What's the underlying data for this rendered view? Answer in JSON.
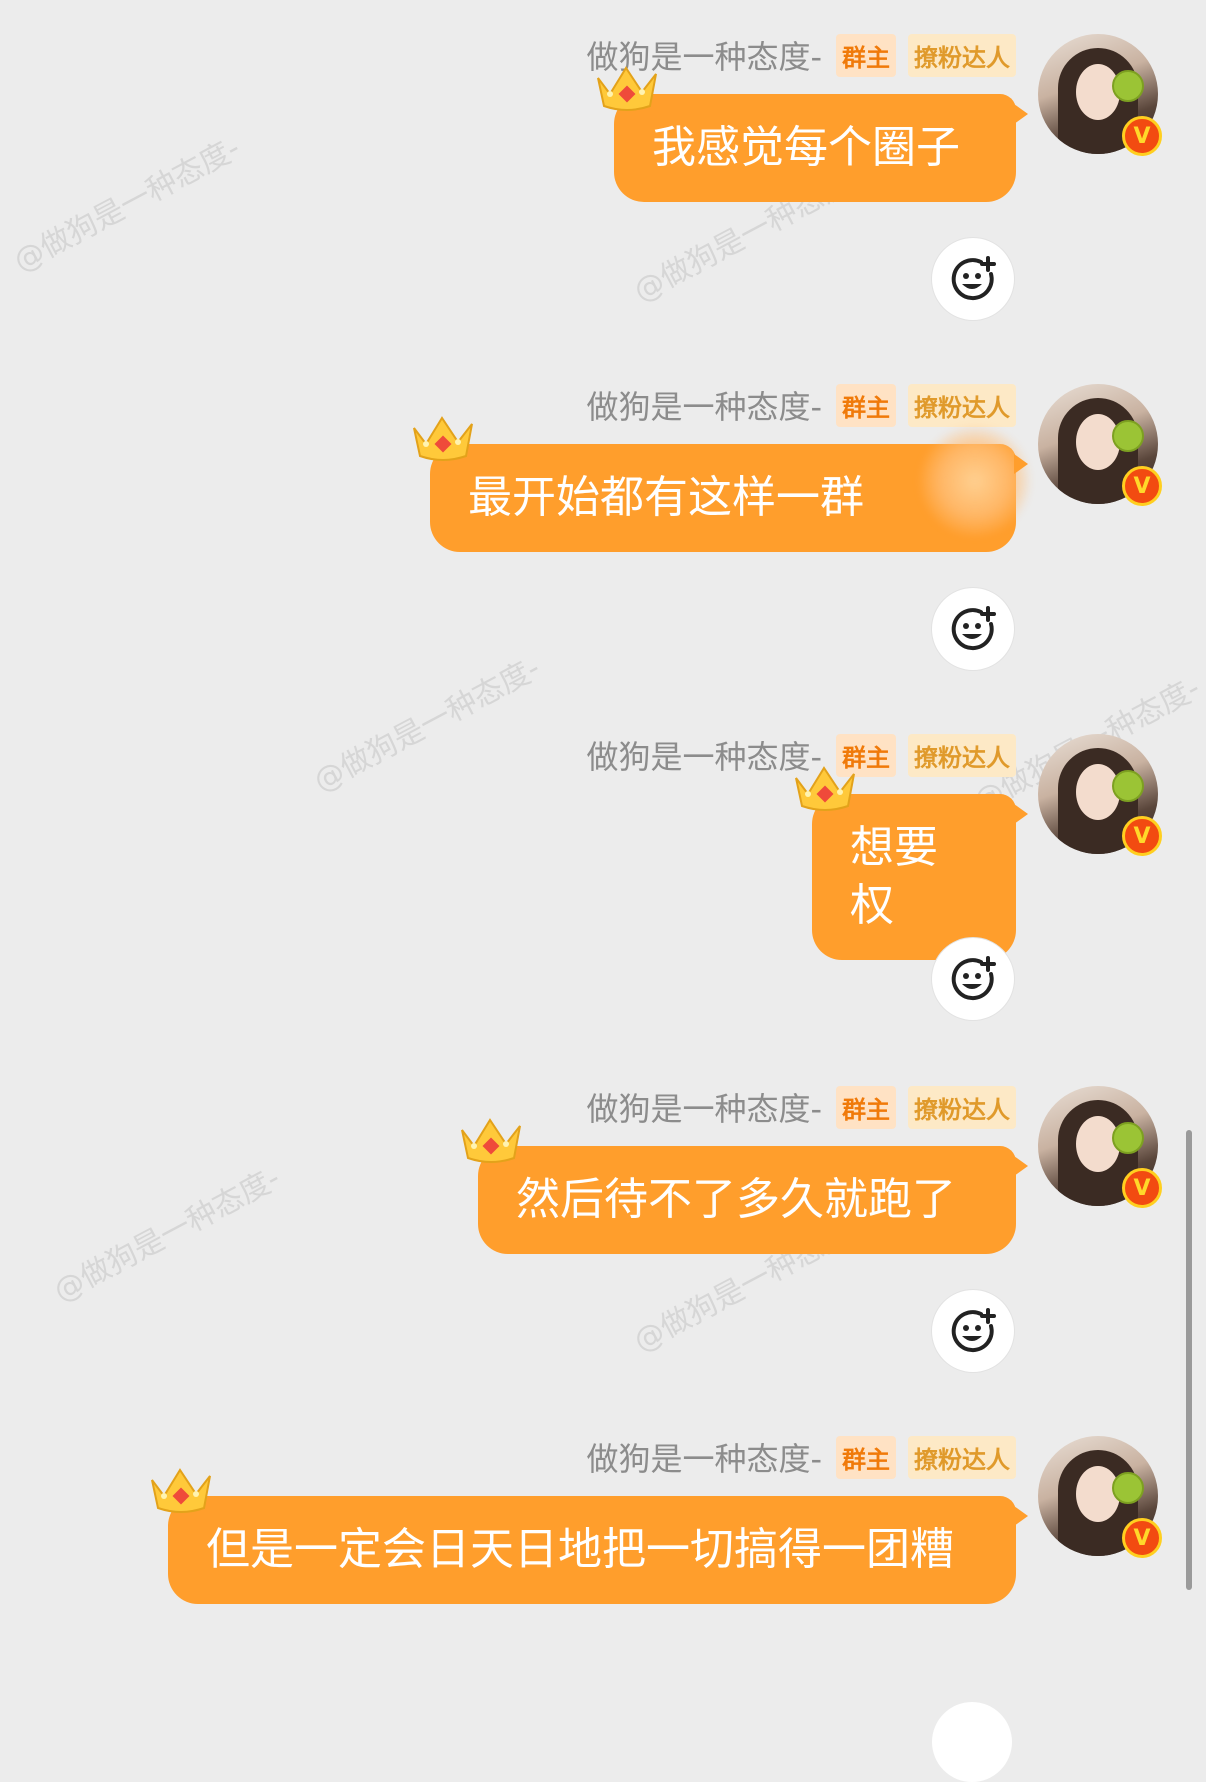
{
  "watermark_text": "@做狗是一种态度-",
  "user": {
    "name": "做狗是一种态度-",
    "badge_owner": "群主",
    "badge_fan": "撩粉达人",
    "verified": "V"
  },
  "messages": [
    {
      "text": "我感觉每个圈子"
    },
    {
      "text": "最开始都有这样一群"
    },
    {
      "text": "想要权"
    },
    {
      "text": "然后待不了多久就跑了"
    },
    {
      "text": "但是一定会日天日地把一切搞得一团糟"
    }
  ],
  "icons": {
    "crown": "crown-icon",
    "react": "emoji-add-icon",
    "verified": "verified-v-icon"
  },
  "colors": {
    "bubble": "#ff9e2c",
    "background": "#ececec",
    "badge_owner_text": "#f07a0a",
    "badge_fan_text": "#e09a2b"
  }
}
